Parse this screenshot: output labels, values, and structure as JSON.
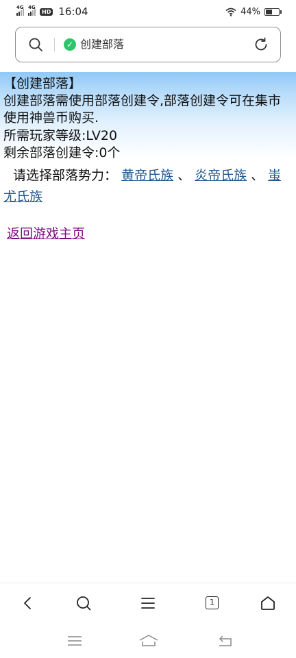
{
  "status_bar": {
    "signal_1_label": "4G",
    "signal_2_label": "4G",
    "hd_badge": "HD",
    "time": "16:04",
    "battery_percent": "44%",
    "battery_level": 0.44
  },
  "address_bar": {
    "page_title": "创建部落",
    "icons": [
      "search-icon",
      "secure-shield-icon",
      "refresh-icon"
    ],
    "secure_color": "#2ec46a"
  },
  "page": {
    "title": "【创建部落】",
    "description": "创建部落需使用部落创建令,部落创建令可在集市使用神兽币购买.",
    "required_level": "所需玩家等级:LV20",
    "remaining_tokens": "剩余部落创建令:0个",
    "faction_prompt": "请选择部落势力：",
    "factions": [
      "黄帝氏族",
      "炎帝氏族",
      "蚩尤氏族"
    ],
    "separator": "、",
    "back_link": "返回游戏主页",
    "link_color": "#24588f",
    "visited_link_color": "#7d0c7f",
    "banner_color": "#8fc8f6"
  },
  "toolbar": {
    "tab_count": "1",
    "icons": [
      "back-icon",
      "search-icon",
      "menu-icon",
      "tabs-icon",
      "home-icon"
    ]
  },
  "system_nav": {
    "icons": [
      "recents-icon",
      "home-icon",
      "back-icon"
    ]
  }
}
